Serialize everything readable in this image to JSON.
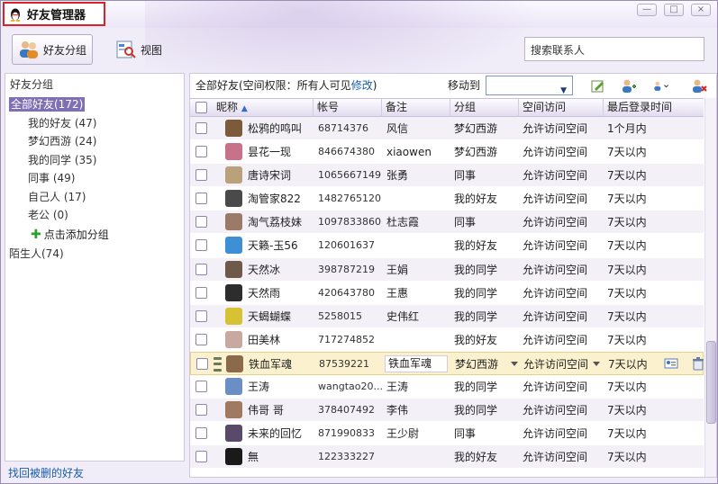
{
  "window": {
    "title": "好友管理器",
    "controls": [
      "—",
      "□",
      "×"
    ]
  },
  "toolbar": {
    "group_button_label": "好友分组",
    "view_button_label": "视图",
    "search_placeholder": "搜索联系人"
  },
  "sidebar": {
    "heading": "好友分组",
    "groups": [
      {
        "label": "全部好友(172)",
        "selected": true,
        "level": 0
      },
      {
        "label": "我的好友 (47)",
        "level": 1
      },
      {
        "label": "梦幻西游 (24)",
        "level": 1
      },
      {
        "label": "我的同学 (35)",
        "level": 1
      },
      {
        "label": "同事 (49)",
        "level": 1
      },
      {
        "label": "自己人 (17)",
        "level": 1
      },
      {
        "label": "老公 (0)",
        "level": 1
      }
    ],
    "add_group_label": "点击添加分组",
    "strangers_label": "陌生人(74)",
    "recover_link": "找回被删的好友"
  },
  "content": {
    "permission_text": "全部好友(空间权限：所有人可见",
    "permission_link": "修改",
    "permission_close": ")",
    "move_to_label": "移动到",
    "move_to_value": "",
    "columns": [
      "昵称",
      "帐号",
      "备注",
      "分组",
      "空间访问",
      "最后登录时间"
    ],
    "rows": [
      {
        "nick": "松鸦的鸣叫",
        "account": "68714376",
        "remark": "风信",
        "group": "梦幻西游",
        "space": "允许访问空间",
        "last": "1个月内",
        "avatar": "#7d5a3a"
      },
      {
        "nick": "昙花一现",
        "account": "846674380",
        "remark": "xiaowen",
        "group": "梦幻西游",
        "space": "允许访问空间",
        "last": "7天以内",
        "avatar": "#c9708a"
      },
      {
        "nick": "唐诗宋词",
        "account": "1065667149",
        "remark": "张勇",
        "group": "同事",
        "space": "允许访问空间",
        "last": "7天以内",
        "avatar": "#b9a27b"
      },
      {
        "nick": "淘管家822",
        "account": "1482765120",
        "remark": "",
        "group": "我的好友",
        "space": "允许访问空间",
        "last": "7天以内",
        "avatar": "#4a4a4a"
      },
      {
        "nick": "淘气荔枝妹",
        "account": "1097833860",
        "remark": "杜志霞",
        "group": "同事",
        "space": "允许访问空间",
        "last": "7天以内",
        "avatar": "#9b7a68"
      },
      {
        "nick": "天籁-玉56",
        "account": "120601637",
        "remark": "",
        "group": "我的好友",
        "space": "允许访问空间",
        "last": "7天以内",
        "avatar": "#3f8fd4"
      },
      {
        "nick": "天然冰",
        "account": "398787219",
        "remark": "王娟",
        "group": "我的同学",
        "space": "允许访问空间",
        "last": "7天以内",
        "avatar": "#6d5a48"
      },
      {
        "nick": "天然雨",
        "account": "420643780",
        "remark": "王惠",
        "group": "我的同学",
        "space": "允许访问空间",
        "last": "7天以内",
        "avatar": "#2d2d2d"
      },
      {
        "nick": "天蝎蝴蝶",
        "account": "5258015",
        "remark": "史伟红",
        "group": "我的同学",
        "space": "允许访问空间",
        "last": "7天以内",
        "avatar": "#d6c233"
      },
      {
        "nick": "田美林",
        "account": "717274852",
        "remark": "",
        "group": "我的好友",
        "space": "允许访问空间",
        "last": "7天以内",
        "avatar": "#c8a9a0"
      },
      {
        "nick": "铁血军魂",
        "account": "87539221",
        "remark": "铁血军魂",
        "group": "梦幻西游",
        "space": "允许访问空间",
        "last": "7天以内",
        "avatar": "#8a6a4a",
        "highlight": true
      },
      {
        "nick": "王涛",
        "account": "wangtao20...",
        "remark": "王涛",
        "group": "我的同学",
        "space": "允许访问空间",
        "last": "7天以内",
        "avatar": "#6b8fc4"
      },
      {
        "nick": "伟哥 哥",
        "account": "378407492",
        "remark": "李伟",
        "group": "我的同学",
        "space": "允许访问空间",
        "last": "7天以内",
        "avatar": "#a07a60"
      },
      {
        "nick": "未来的回忆",
        "account": "871990833",
        "remark": "王少尉",
        "group": "同事",
        "space": "允许访问空间",
        "last": "7天以内",
        "avatar": "#5a4a6a"
      },
      {
        "nick": "無",
        "account": "122333227",
        "remark": "",
        "group": "我的好友",
        "space": "允许访问空间",
        "last": "7天以内",
        "avatar": "#1a1a1a"
      }
    ]
  },
  "colors": {
    "accent": "#7f6fb3",
    "link": "#1a5ea8",
    "title_border": "#d8232a",
    "highlight_row": "#fbf1cf"
  }
}
